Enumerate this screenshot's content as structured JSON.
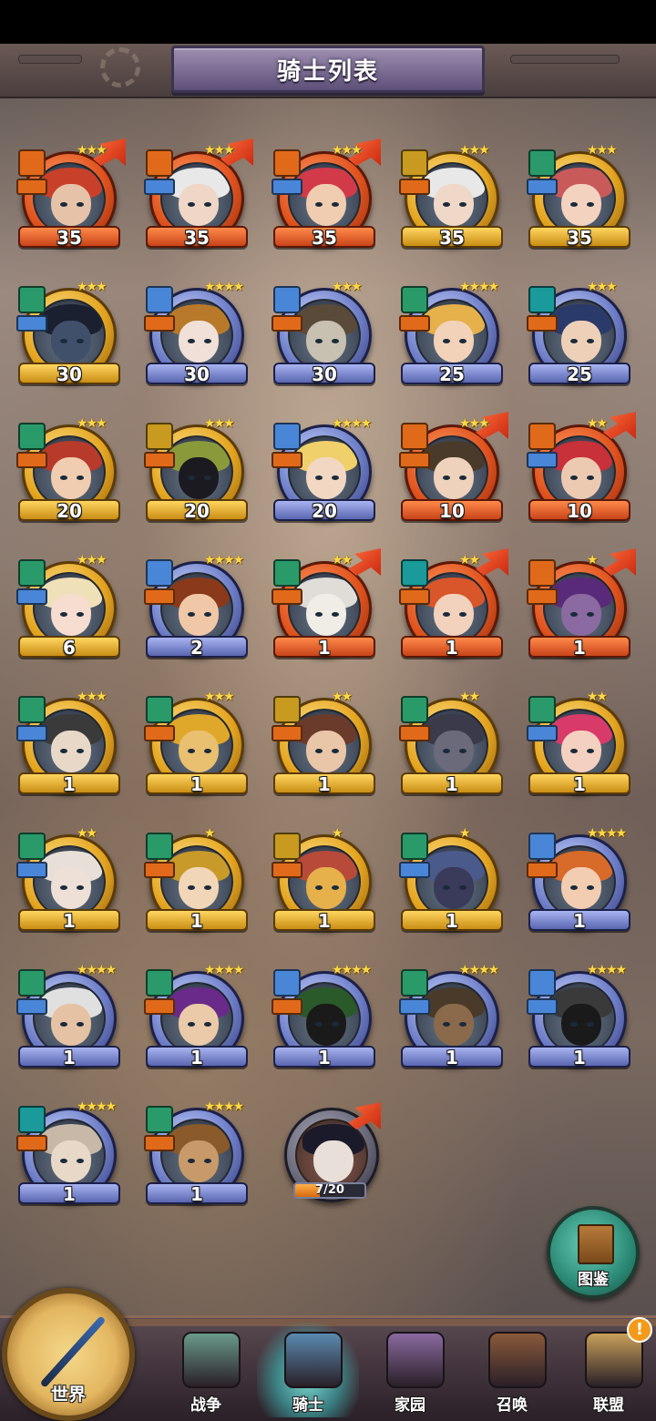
{
  "header": {
    "title": "骑士列表"
  },
  "colors": {
    "gold_frame": "#e4a520",
    "red_frame": "#e0531e",
    "blue_frame": "#6f7fc8",
    "class_blue": "#4a86d8",
    "class_orange": "#e06a1a",
    "class_green": "#2a9a6a",
    "class_teal": "#1a9a9a",
    "active_tab_glow": "#7ff0e6",
    "alert": "#f39a1a"
  },
  "knights": [
    {
      "level": "35",
      "stars": "★★★",
      "frame": "red",
      "class_color": "#e06a1a",
      "role_color": "#e06a1a",
      "arrow": true,
      "hair": "#c8402a",
      "skin": "#e6c3a8"
    },
    {
      "level": "35",
      "stars": "★★★",
      "frame": "red",
      "class_color": "#e06a1a",
      "role_color": "#4a86d8",
      "arrow": true,
      "hair": "#e8e8e8",
      "skin": "#efd6c6"
    },
    {
      "level": "35",
      "stars": "★★★",
      "frame": "red",
      "class_color": "#e06a1a",
      "role_color": "#4a86d8",
      "arrow": true,
      "hair": "#d23a4a",
      "skin": "#f0cdb0"
    },
    {
      "level": "35",
      "stars": "★★★",
      "frame": "gold",
      "class_color": "#c99a20",
      "role_color": "#e06a1a",
      "arrow": false,
      "hair": "#e8e8e8",
      "skin": "#f0d8c8"
    },
    {
      "level": "35",
      "stars": "★★★",
      "frame": "gold",
      "class_color": "#2a9a6a",
      "role_color": "#4a86d8",
      "arrow": false,
      "hair": "#c85a5a",
      "skin": "#f4d2c0"
    },
    {
      "level": "30",
      "stars": "★★★",
      "frame": "gold",
      "class_color": "#2a9a6a",
      "role_color": "#4a86d8",
      "arrow": false,
      "hair": "#1a2030",
      "skin": "#40506a"
    },
    {
      "level": "30",
      "stars": "★★★★",
      "frame": "blue",
      "class_color": "#4a86d8",
      "role_color": "#e06a1a",
      "arrow": false,
      "hair": "#b87a2a",
      "skin": "#f0e0d8"
    },
    {
      "level": "30",
      "stars": "★★★",
      "frame": "blue",
      "class_color": "#4a86d8",
      "role_color": "#e06a1a",
      "arrow": false,
      "hair": "#5a4a3a",
      "skin": "#c8c0b0"
    },
    {
      "level": "25",
      "stars": "★★★★",
      "frame": "blue",
      "class_color": "#2a9a6a",
      "role_color": "#e06a1a",
      "arrow": false,
      "hair": "#e6b04a",
      "skin": "#f2d2b8"
    },
    {
      "level": "25",
      "stars": "★★★",
      "frame": "blue",
      "class_color": "#1a9a9a",
      "role_color": "#e06a1a",
      "arrow": false,
      "hair": "#2a3a6a",
      "skin": "#eed0b8"
    },
    {
      "level": "20",
      "stars": "★★★",
      "frame": "gold",
      "class_color": "#2a9a6a",
      "role_color": "#e06a1a",
      "arrow": false,
      "hair": "#b83a2a",
      "skin": "#f0cdb0"
    },
    {
      "level": "20",
      "stars": "★★★",
      "frame": "gold",
      "class_color": "#c99a20",
      "role_color": "#e06a1a",
      "arrow": false,
      "hair": "#8a9a3a",
      "skin": "#1a1a20"
    },
    {
      "level": "20",
      "stars": "★★★★",
      "frame": "blue",
      "class_color": "#4a86d8",
      "role_color": "#e06a1a",
      "arrow": false,
      "hair": "#f0d06a",
      "skin": "#f2d8c2"
    },
    {
      "level": "10",
      "stars": "★★★",
      "frame": "red",
      "class_color": "#e06a1a",
      "role_color": "#e06a1a",
      "arrow": true,
      "hair": "#4a3a2a",
      "skin": "#eed2bc"
    },
    {
      "level": "10",
      "stars": "★★",
      "frame": "red",
      "class_color": "#e06a1a",
      "role_color": "#4a86d8",
      "arrow": true,
      "hair": "#c8303a",
      "skin": "#eccab2"
    },
    {
      "level": "6",
      "stars": "★★★",
      "frame": "gold",
      "class_color": "#2a9a6a",
      "role_color": "#4a86d8",
      "arrow": false,
      "hair": "#f0e0b8",
      "skin": "#f6ddd0"
    },
    {
      "level": "2",
      "stars": "★★★★",
      "frame": "blue",
      "class_color": "#4a86d8",
      "role_color": "#e06a1a",
      "arrow": false,
      "hair": "#8a3a1a",
      "skin": "#f0c8a8"
    },
    {
      "level": "1",
      "stars": "★★",
      "frame": "red",
      "class_color": "#2a9a6a",
      "role_color": "#e06a1a",
      "arrow": true,
      "hair": "#e0ddd8",
      "skin": "#f0ece6"
    },
    {
      "level": "1",
      "stars": "★★",
      "frame": "red",
      "class_color": "#1a9a9a",
      "role_color": "#e06a1a",
      "arrow": true,
      "hair": "#d8562a",
      "skin": "#f2d2bc"
    },
    {
      "level": "1",
      "stars": "★",
      "frame": "red",
      "class_color": "#e06a1a",
      "role_color": "#e06a1a",
      "arrow": true,
      "hair": "#5a2a7a",
      "skin": "#8a6aa0"
    },
    {
      "level": "1",
      "stars": "★★★",
      "frame": "gold",
      "class_color": "#2a9a6a",
      "role_color": "#4a86d8",
      "arrow": false,
      "hair": "#3a3a3a",
      "skin": "#e8d8c8"
    },
    {
      "level": "1",
      "stars": "★★★",
      "frame": "gold",
      "class_color": "#2a9a6a",
      "role_color": "#e06a1a",
      "arrow": false,
      "hair": "#e0a82a",
      "skin": "#e8c070"
    },
    {
      "level": "1",
      "stars": "★★",
      "frame": "gold",
      "class_color": "#c99a20",
      "role_color": "#e06a1a",
      "arrow": false,
      "hair": "#6a3a2a",
      "skin": "#eac6a8"
    },
    {
      "level": "1",
      "stars": "★★",
      "frame": "gold",
      "class_color": "#2a9a6a",
      "role_color": "#e06a1a",
      "arrow": false,
      "hair": "#3a3a4a",
      "skin": "#6a6a7a"
    },
    {
      "level": "1",
      "stars": "★★",
      "frame": "gold",
      "class_color": "#2a9a6a",
      "role_color": "#4a86d8",
      "arrow": false,
      "hair": "#d83a6a",
      "skin": "#f4d0c0"
    },
    {
      "level": "1",
      "stars": "★★",
      "frame": "gold",
      "class_color": "#2a9a6a",
      "role_color": "#4a86d8",
      "arrow": false,
      "hair": "#e8e0d8",
      "skin": "#eee0d6"
    },
    {
      "level": "1",
      "stars": "★",
      "frame": "gold",
      "class_color": "#2a9a6a",
      "role_color": "#e06a1a",
      "arrow": false,
      "hair": "#c89a2a",
      "skin": "#f2d6b8"
    },
    {
      "level": "1",
      "stars": "★",
      "frame": "gold",
      "class_color": "#c99a20",
      "role_color": "#e06a1a",
      "arrow": false,
      "hair": "#b84a3a",
      "skin": "#e6b04a"
    },
    {
      "level": "1",
      "stars": "★",
      "frame": "gold",
      "class_color": "#2a9a6a",
      "role_color": "#4a86d8",
      "arrow": false,
      "hair": "#4a5a8a",
      "skin": "#3a3a5a"
    },
    {
      "level": "1",
      "stars": "★★★★",
      "frame": "blue",
      "class_color": "#4a86d8",
      "role_color": "#e06a1a",
      "arrow": false,
      "hair": "#d86a2a",
      "skin": "#f2cdb2"
    },
    {
      "level": "1",
      "stars": "★★★★",
      "frame": "blue",
      "class_color": "#2a9a6a",
      "role_color": "#4a86d8",
      "arrow": false,
      "hair": "#e0e0e0",
      "skin": "#e6c2a4"
    },
    {
      "level": "1",
      "stars": "★★★★",
      "frame": "blue",
      "class_color": "#2a9a6a",
      "role_color": "#e06a1a",
      "arrow": false,
      "hair": "#6a2a8a",
      "skin": "#eacaa8"
    },
    {
      "level": "1",
      "stars": "★★★★",
      "frame": "blue",
      "class_color": "#4a86d8",
      "role_color": "#e06a1a",
      "arrow": false,
      "hair": "#2a5a2a",
      "skin": "#1a1a1a"
    },
    {
      "level": "1",
      "stars": "★★★★",
      "frame": "blue",
      "class_color": "#2a9a6a",
      "role_color": "#4a86d8",
      "arrow": false,
      "hair": "#4a3a2a",
      "skin": "#8a6a4a"
    },
    {
      "level": "1",
      "stars": "★★★★",
      "frame": "blue",
      "class_color": "#4a86d8",
      "role_color": "#4a86d8",
      "arrow": false,
      "hair": "#3a3a3a",
      "skin": "#1a1a1a"
    },
    {
      "level": "1",
      "stars": "★★★★",
      "frame": "blue",
      "class_color": "#1a9a9a",
      "role_color": "#e06a1a",
      "arrow": false,
      "hair": "#c8b8a8",
      "skin": "#e8d8c8"
    },
    {
      "level": "1",
      "stars": "★★★★",
      "frame": "blue",
      "class_color": "#2a9a6a",
      "role_color": "#e06a1a",
      "arrow": false,
      "hair": "#8a5a2a",
      "skin": "#c89a6a"
    }
  ],
  "pending_knight": {
    "progress_text": "7/20",
    "progress_fraction": 0.35,
    "hair": "#1a1a2a",
    "skin": "#e8e0d8"
  },
  "codex_button": {
    "label": "图鉴"
  },
  "bottom_nav": {
    "world": "世界",
    "tabs": [
      {
        "label": "战争",
        "color": "#6a9a8a",
        "active": false
      },
      {
        "label": "骑士",
        "color": "#5a8ab0",
        "active": true
      },
      {
        "label": "家园",
        "color": "#8a6aa0",
        "active": false
      },
      {
        "label": "召唤",
        "color": "#8a5a3a",
        "active": false
      },
      {
        "label": "联盟",
        "color": "#c8a05a",
        "active": false
      }
    ],
    "alert_symbol": "!"
  }
}
